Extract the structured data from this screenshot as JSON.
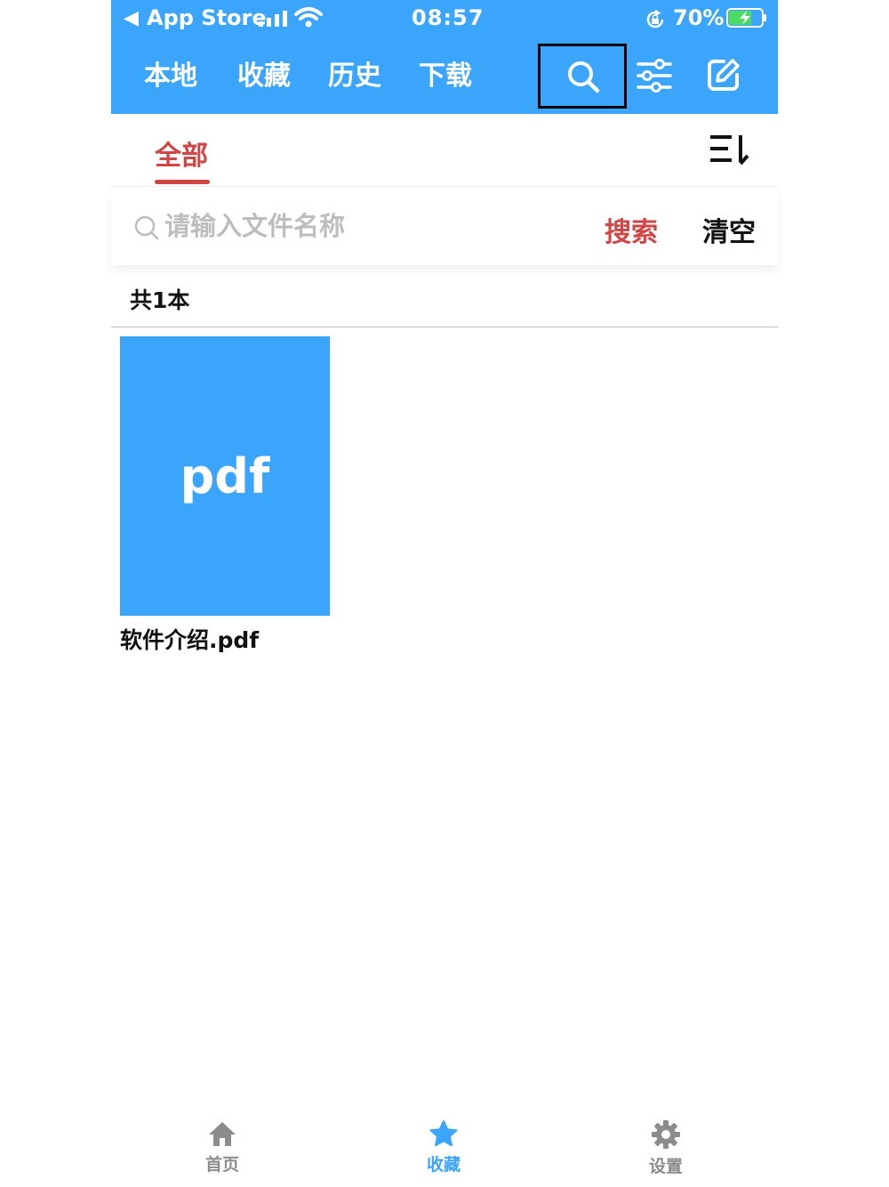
{
  "status_bar": {
    "back_label": "◀",
    "carrier": "App Store",
    "time": "08:57",
    "battery_percent": "70%",
    "battery_level": 0.7
  },
  "top_nav": {
    "tabs": [
      {
        "label": "本地"
      },
      {
        "label": "收藏"
      },
      {
        "label": "历史"
      },
      {
        "label": "下载"
      }
    ],
    "icons": [
      "search-icon",
      "sliders-icon",
      "edit-icon"
    ]
  },
  "sub_tabs": {
    "active": "全部",
    "sort_icon": "sort-icon"
  },
  "search": {
    "placeholder": "请输入文件名称",
    "value": "",
    "search_label": "搜索",
    "clear_label": "清空"
  },
  "list": {
    "count_text": "共1本",
    "items": [
      {
        "thumb_text": "pdf",
        "name": "软件介绍.pdf"
      }
    ]
  },
  "bottom_tabs": [
    {
      "label": "首页",
      "icon": "home-icon"
    },
    {
      "label": "收藏",
      "icon": "star-icon"
    },
    {
      "label": "设置",
      "icon": "gear-icon"
    }
  ],
  "colors": {
    "primary": "#3aa5fb",
    "accent_red": "#d24545",
    "inactive": "#8c8c8c"
  }
}
